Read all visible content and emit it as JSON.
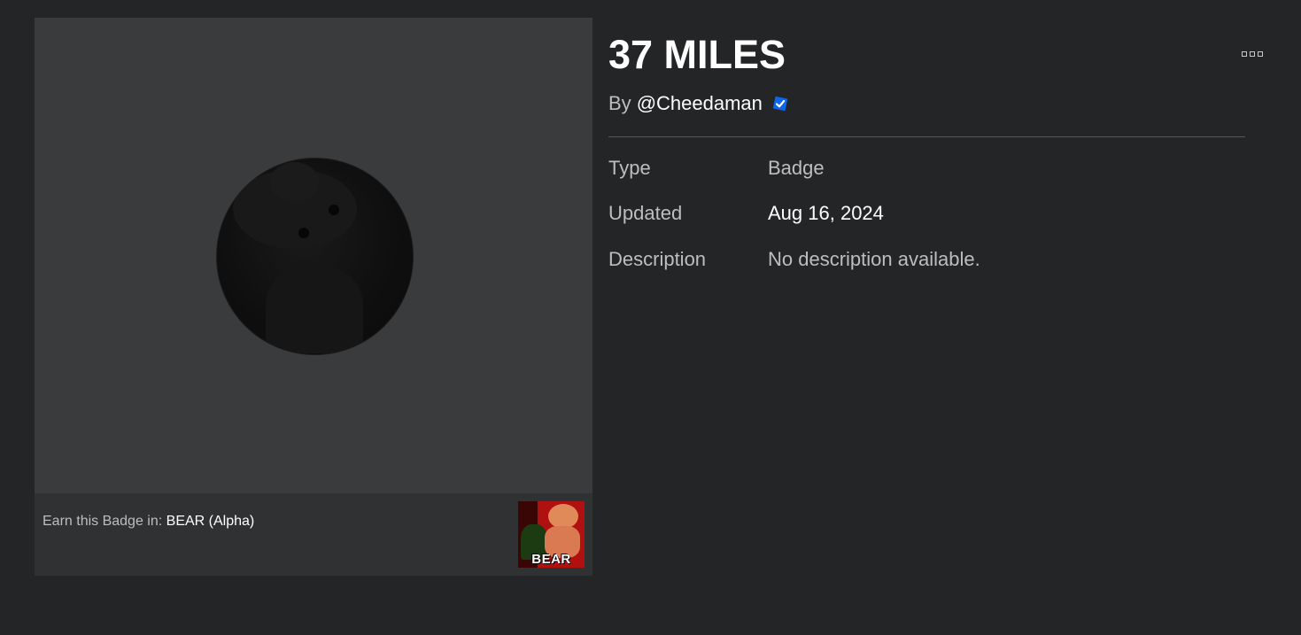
{
  "badge": {
    "title": "37 MILES",
    "by_prefix": "By",
    "creator": "@Cheedaman",
    "verified_icon": "verified-check-icon",
    "more_icon": "more-options-icon"
  },
  "details": {
    "type_label": "Type",
    "type_value": "Badge",
    "updated_label": "Updated",
    "updated_value": "Aug 16, 2024",
    "description_label": "Description",
    "description_value": "No description available."
  },
  "earn": {
    "prefix": "Earn this Badge in:",
    "game_name": "BEAR (Alpha)",
    "thumbnail_text": "BEAR"
  },
  "colors": {
    "background": "#232527",
    "card": "#393b3d",
    "footer": "#2f3133",
    "verified": "#0b66ee",
    "muted_text": "#bdbebe"
  }
}
